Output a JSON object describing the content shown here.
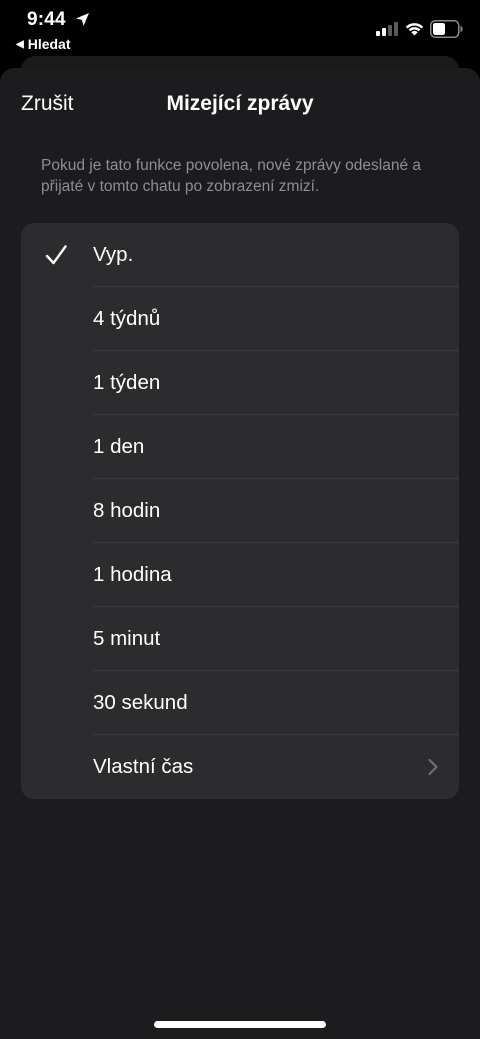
{
  "status_bar": {
    "time": "9:44",
    "back_app": "Hledat"
  },
  "nav": {
    "cancel_label": "Zrušit",
    "title": "Mizející zprávy"
  },
  "description": "Pokud je tato funkce povolena, nové zprávy odeslané a přijaté v tomto chatu po zobrazení zmizí.",
  "options": [
    {
      "label": "Vyp.",
      "selected": true
    },
    {
      "label": "4 týdnů",
      "selected": false
    },
    {
      "label": "1 týden",
      "selected": false
    },
    {
      "label": "1 den",
      "selected": false
    },
    {
      "label": "8 hodin",
      "selected": false
    },
    {
      "label": "1 hodina",
      "selected": false
    },
    {
      "label": "5 minut",
      "selected": false
    },
    {
      "label": "30 sekund",
      "selected": false
    },
    {
      "label": "Vlastní čas",
      "selected": false,
      "has_chevron": true
    }
  ],
  "colors": {
    "sheet_bg": "#1c1c1e",
    "group_bg": "#2c2c2e",
    "secondary_text": "#8e8e93"
  }
}
